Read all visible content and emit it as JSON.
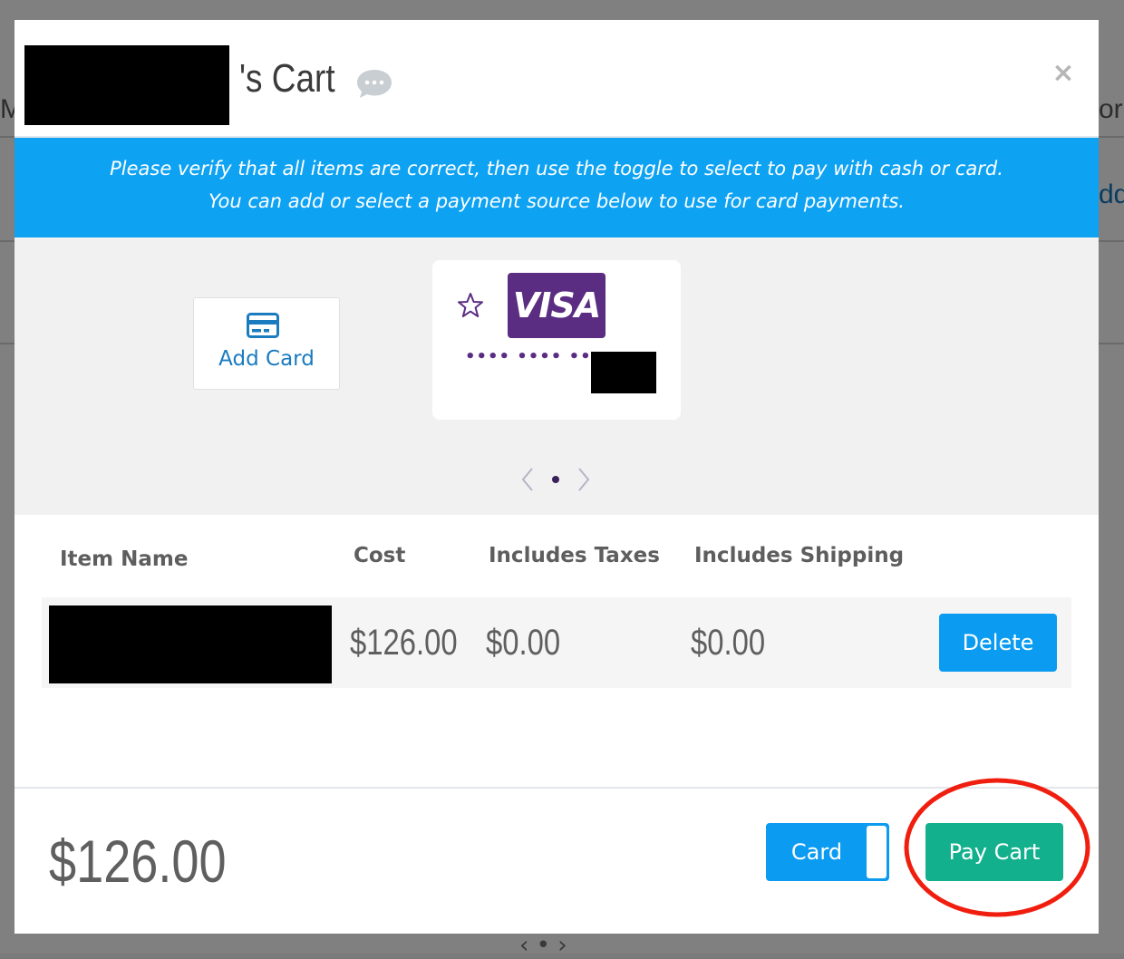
{
  "background": {
    "left_text_1": "M",
    "right_text_1": "or",
    "right_text_2": "ddl",
    "pager_text": "‹ • ›"
  },
  "header": {
    "title_suffix": "'s Cart",
    "chat_icon": "chat-bubble-icon",
    "close_label": "×"
  },
  "banner": {
    "line1": "Please verify that all items are correct, then use the toggle to select to pay with cash or card.",
    "line2": "You can add or select a payment source below to use for card payments.",
    "color": "#0ea2f3"
  },
  "payment_sources": {
    "add_card_label": "Add Card",
    "add_card_icon": "credit-card-icon",
    "card": {
      "brand": "VISA",
      "masked_number": "•••• •••• ••••",
      "favorite_icon": "star-outline-icon",
      "brand_color": "#5a2d82"
    },
    "carousel": {
      "current_page": 1,
      "page_count": 1
    }
  },
  "table": {
    "headers": {
      "name": "Item Name",
      "cost": "Cost",
      "taxes": "Includes Taxes",
      "shipping": "Includes Shipping"
    },
    "rows": [
      {
        "cost": "$126.00",
        "taxes": "$0.00",
        "shipping": "$0.00",
        "action_label": "Delete"
      }
    ]
  },
  "footer": {
    "total": "$126.00",
    "payment_toggle_label": "Card",
    "pay_label": "Pay Cart",
    "pay_color": "#12b08d",
    "annotation_color": "#f01e0e"
  }
}
